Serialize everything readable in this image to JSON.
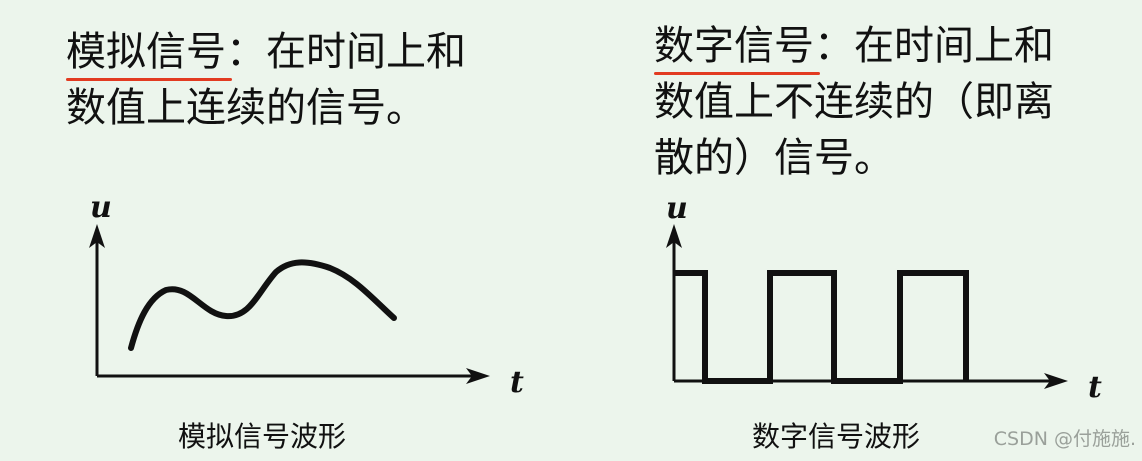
{
  "analog": {
    "term": "模拟信号",
    "line1_rest": "：在时间上和",
    "line2": "数值上连续的信号。",
    "caption": "模拟信号波形",
    "y_label": "u",
    "x_label": "t"
  },
  "digital": {
    "term": "数字信号",
    "line1_rest": "：在时间上和",
    "line2": "数值上不连续的（即离",
    "line3": "散的）信号。",
    "caption": "数字信号波形",
    "y_label": "u",
    "x_label": "t"
  },
  "watermark": "CSDN @付施施.",
  "colors": {
    "underline": "#e23b21",
    "ink": "#111111",
    "background": "#ecf5ec"
  }
}
